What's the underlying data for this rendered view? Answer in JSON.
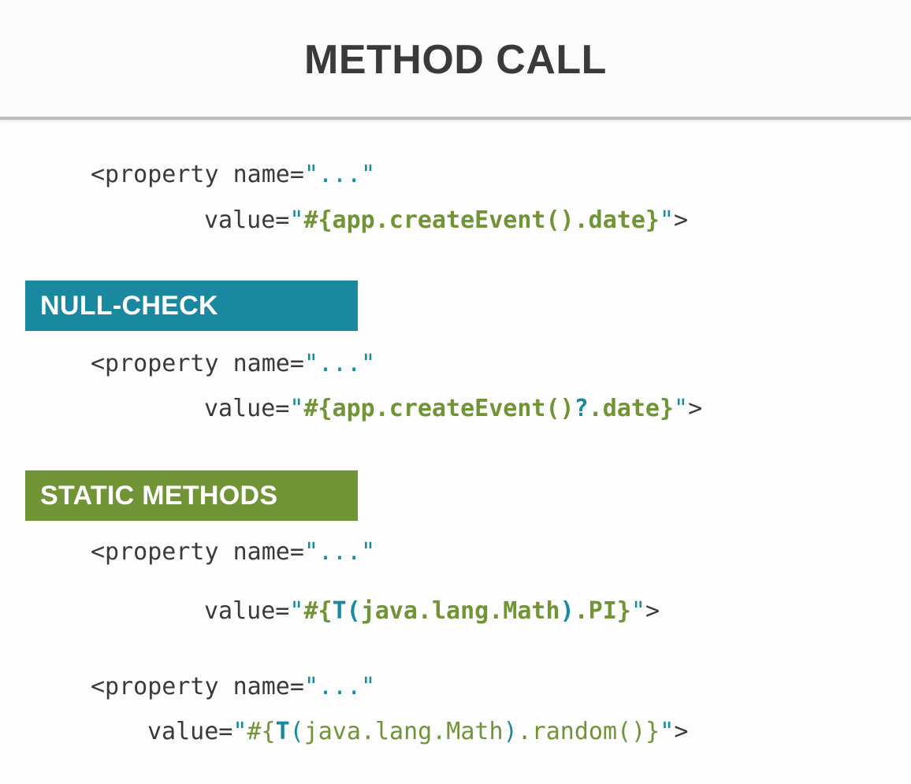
{
  "title": "METHOD CALL",
  "colors": {
    "teal": "#1a889f",
    "green": "#709436",
    "code_text": "#3a3a3a",
    "title_text": "#3a3a3a",
    "banner_text": "#ffffff"
  },
  "sections": {
    "null_check_label": "NULL-CHECK",
    "static_methods_label": "STATIC METHODS"
  },
  "code": {
    "block1": {
      "line1": [
        {
          "text": "<property name=",
          "style": "plain"
        },
        {
          "text": "\"...\"",
          "style": "teal"
        }
      ],
      "line2": [
        {
          "text": "value=",
          "style": "plain"
        },
        {
          "text": "\"",
          "style": "teal"
        },
        {
          "text": "#{app.createEvent().date}",
          "style": "green-bold"
        },
        {
          "text": "\"",
          "style": "teal"
        },
        {
          "text": ">",
          "style": "plain"
        }
      ]
    },
    "block2": {
      "line1": [
        {
          "text": "<property name=",
          "style": "plain"
        },
        {
          "text": "\"...\"",
          "style": "teal"
        }
      ],
      "line2": [
        {
          "text": "value=",
          "style": "plain"
        },
        {
          "text": "\"",
          "style": "teal"
        },
        {
          "text": "#{app.createEvent()",
          "style": "green-bold"
        },
        {
          "text": "?",
          "style": "teal-bold"
        },
        {
          "text": ".date}",
          "style": "green-bold"
        },
        {
          "text": "\"",
          "style": "teal"
        },
        {
          "text": ">",
          "style": "plain"
        }
      ]
    },
    "block3": {
      "line1": [
        {
          "text": "<property name=",
          "style": "plain"
        },
        {
          "text": "\"...\"",
          "style": "teal"
        }
      ],
      "line2": [
        {
          "text": "value=",
          "style": "plain"
        },
        {
          "text": "\"",
          "style": "teal"
        },
        {
          "text": "#{",
          "style": "green-bold"
        },
        {
          "text": "T(",
          "style": "teal-bold"
        },
        {
          "text": "java.lang.Math",
          "style": "green-bold"
        },
        {
          "text": ")",
          "style": "teal-bold"
        },
        {
          "text": ".PI}",
          "style": "green-bold"
        },
        {
          "text": "\"",
          "style": "teal"
        },
        {
          "text": ">",
          "style": "plain"
        }
      ]
    },
    "block4": {
      "line1": [
        {
          "text": "<property name=",
          "style": "plain"
        },
        {
          "text": "\"...\"",
          "style": "teal"
        }
      ],
      "line2": [
        {
          "text": "value=",
          "style": "plain"
        },
        {
          "text": "\"",
          "style": "teal"
        },
        {
          "text": "#{",
          "style": "green"
        },
        {
          "text": "T",
          "style": "teal-bold"
        },
        {
          "text": "(",
          "style": "teal"
        },
        {
          "text": "java.lang.Math",
          "style": "green"
        },
        {
          "text": ")",
          "style": "teal"
        },
        {
          "text": ".random()}",
          "style": "green"
        },
        {
          "text": "\"",
          "style": "teal"
        },
        {
          "text": ">",
          "style": "plain"
        }
      ]
    }
  }
}
